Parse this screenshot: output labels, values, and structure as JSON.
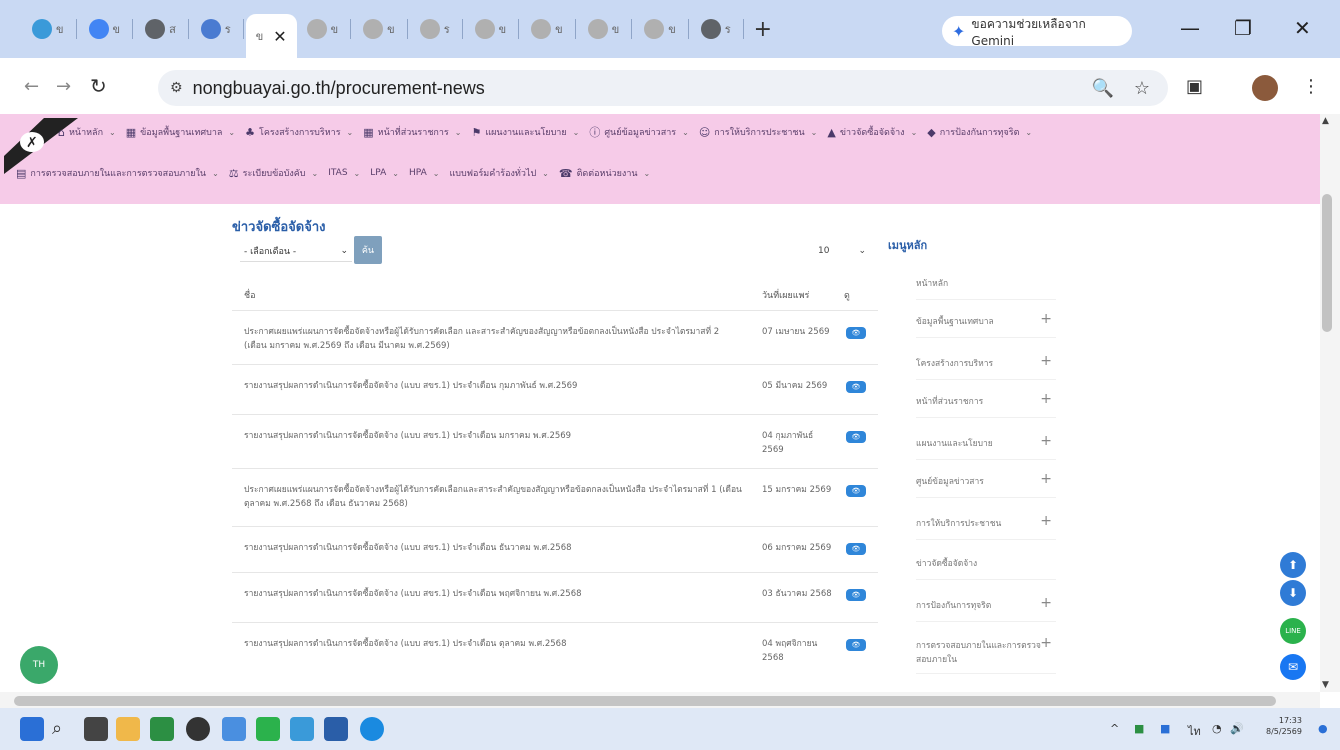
{
  "browser": {
    "tabs": [
      {
        "label": "ข",
        "color": "#3a9ad9"
      },
      {
        "label": "ข",
        "color": "#4285f4"
      },
      {
        "label": "ส",
        "color": "#5f6368"
      },
      {
        "label": "ร",
        "color": "#4a7bd1"
      },
      {
        "label": "ข",
        "color": "#b0b0b0"
      },
      {
        "label": "ข",
        "color": "#b0b0b0"
      },
      {
        "label": "ร",
        "color": "#b0b0b0"
      },
      {
        "label": "ข",
        "color": "#b0b0b0"
      },
      {
        "label": "ข",
        "color": "#b0b0b0"
      },
      {
        "label": "ข",
        "color": "#b0b0b0"
      },
      {
        "label": "ข",
        "color": "#b0b0b0"
      },
      {
        "label": "ร",
        "color": "#5f6368"
      }
    ],
    "active_tab_label": "ข",
    "gemini_label": "ขอความช่วยเหลือจาก Gemini",
    "url": "nongbuayai.go.th/procurement-news"
  },
  "nav": {
    "row1": [
      {
        "label": "หน้าหลัก",
        "icon": "home-icon"
      },
      {
        "label": "ข้อมูลพื้นฐานเทศบาล",
        "icon": "building-icon"
      },
      {
        "label": "โครงสร้างการบริหาร",
        "icon": "org-icon"
      },
      {
        "label": "หน้าที่ส่วนราชการ",
        "icon": "building-icon"
      },
      {
        "label": "แผนงานและนโยบาย",
        "icon": "flag-icon"
      },
      {
        "label": "ศูนย์ข้อมูลข่าวสาร",
        "icon": "info-icon"
      },
      {
        "label": "การให้บริการประชาชน",
        "icon": "people-icon"
      },
      {
        "label": "ข่าวจัดซื้อจัดจ้าง",
        "icon": "cart-icon"
      },
      {
        "label": "การป้องกันการทุจริต",
        "icon": "shield-icon"
      }
    ],
    "row2": [
      {
        "label": "การตรวจสอบภายในและการตรวจสอบภายใน",
        "icon": "doc-icon"
      },
      {
        "label": "ระเบียบข้อบังคับ",
        "icon": "gavel-icon"
      },
      {
        "label": "ITAS",
        "icon": ""
      },
      {
        "label": "LPA",
        "icon": ""
      },
      {
        "label": "HPA",
        "icon": ""
      },
      {
        "label": "แบบฟอร์มคำร้องทั่วไป",
        "icon": ""
      },
      {
        "label": "ติดต่อหน่วยงาน",
        "icon": "phone-icon"
      }
    ]
  },
  "main": {
    "title": "ข่าวจัดซื้อจัดจ้าง",
    "month_select": "- เลือกเดือน -",
    "search_button": "ค้น",
    "per_page": "10",
    "columns": {
      "name": "ชื่อ",
      "date": "วันที่เผยแพร่",
      "view": "ดู"
    },
    "rows": [
      {
        "title": "ประกาศเผยแพร่แผนการจัดซื้อจัดจ้างหรือผู้ได้รับการคัดเลือก และสาระสำคัญของสัญญาหรือข้อตกลงเป็นหนังสือ ประจำไตรมาสที่ 2 (เดือน มกราคม พ.ศ.2569 ถึง เดือน มีนาคม พ.ศ.2569)",
        "date": "07 เมษายน 2569"
      },
      {
        "title": "รายงานสรุปผลการดำเนินการจัดซื้อจัดจ้าง (แบบ สขร.1) ประจำเดือน กุมภาพันธ์ พ.ศ.2569",
        "date": "05 มีนาคม 2569"
      },
      {
        "title": "รายงานสรุปผลการดำเนินการจัดซื้อจัดจ้าง (แบบ สขร.1) ประจำเดือน มกราคม พ.ศ.2569",
        "date": "04 กุมภาพันธ์ 2569"
      },
      {
        "title": "ประกาศเผยแพร่แผนการจัดซื้อจัดจ้างหรือผู้ได้รับการคัดเลือกและสาระสำคัญของสัญญาหรือข้อตกลงเป็นหนังสือ ประจำไตรมาสที่ 1 (เดือน ตุลาคม พ.ศ.2568 ถึง เดือน ธันวาคม 2568)",
        "date": "15 มกราคม 2569"
      },
      {
        "title": "รายงานสรุปผลการดำเนินการจัดซื้อจัดจ้าง (แบบ สขร.1) ประจำเดือน ธันวาคม พ.ศ.2568",
        "date": "06 มกราคม 2569"
      },
      {
        "title": "รายงานสรุปผลการดำเนินการจัดซื้อจัดจ้าง (แบบ สขร.1) ประจำเดือน พฤศจิกายน พ.ศ.2568",
        "date": "03 ธันวาคม 2568"
      },
      {
        "title": "รายงานสรุปผลการดำเนินการจัดซื้อจัดจ้าง (แบบ สขร.1) ประจำเดือน ตุลาคม พ.ศ.2568",
        "date": "04 พฤศจิกายน 2568"
      }
    ]
  },
  "sidebar": {
    "title": "เมนูหลัก",
    "items": [
      {
        "label": "หน้าหลัก",
        "plus": ""
      },
      {
        "label": "ข้อมูลพื้นฐานเทศบาล",
        "plus": "+"
      },
      {
        "label": "โครงสร้างการบริหาร",
        "plus": "+"
      },
      {
        "label": "หน้าที่ส่วนราชการ",
        "plus": "+"
      },
      {
        "label": "แผนงานและนโยบาย",
        "plus": "+"
      },
      {
        "label": "ศูนย์ข้อมูลข่าวสาร",
        "plus": "+"
      },
      {
        "label": "การให้บริการประชาชน",
        "plus": "+"
      },
      {
        "label": "ข่าวจัดซื้อจัดจ้าง",
        "plus": ""
      },
      {
        "label": "การป้องกันการทุจริต",
        "plus": "+"
      },
      {
        "label": "การตรวจสอบภายในและการตรวจสอบภายใน",
        "plus": "+"
      }
    ]
  },
  "taskbar": {
    "time": "17:33",
    "date": "8/5/2569"
  }
}
